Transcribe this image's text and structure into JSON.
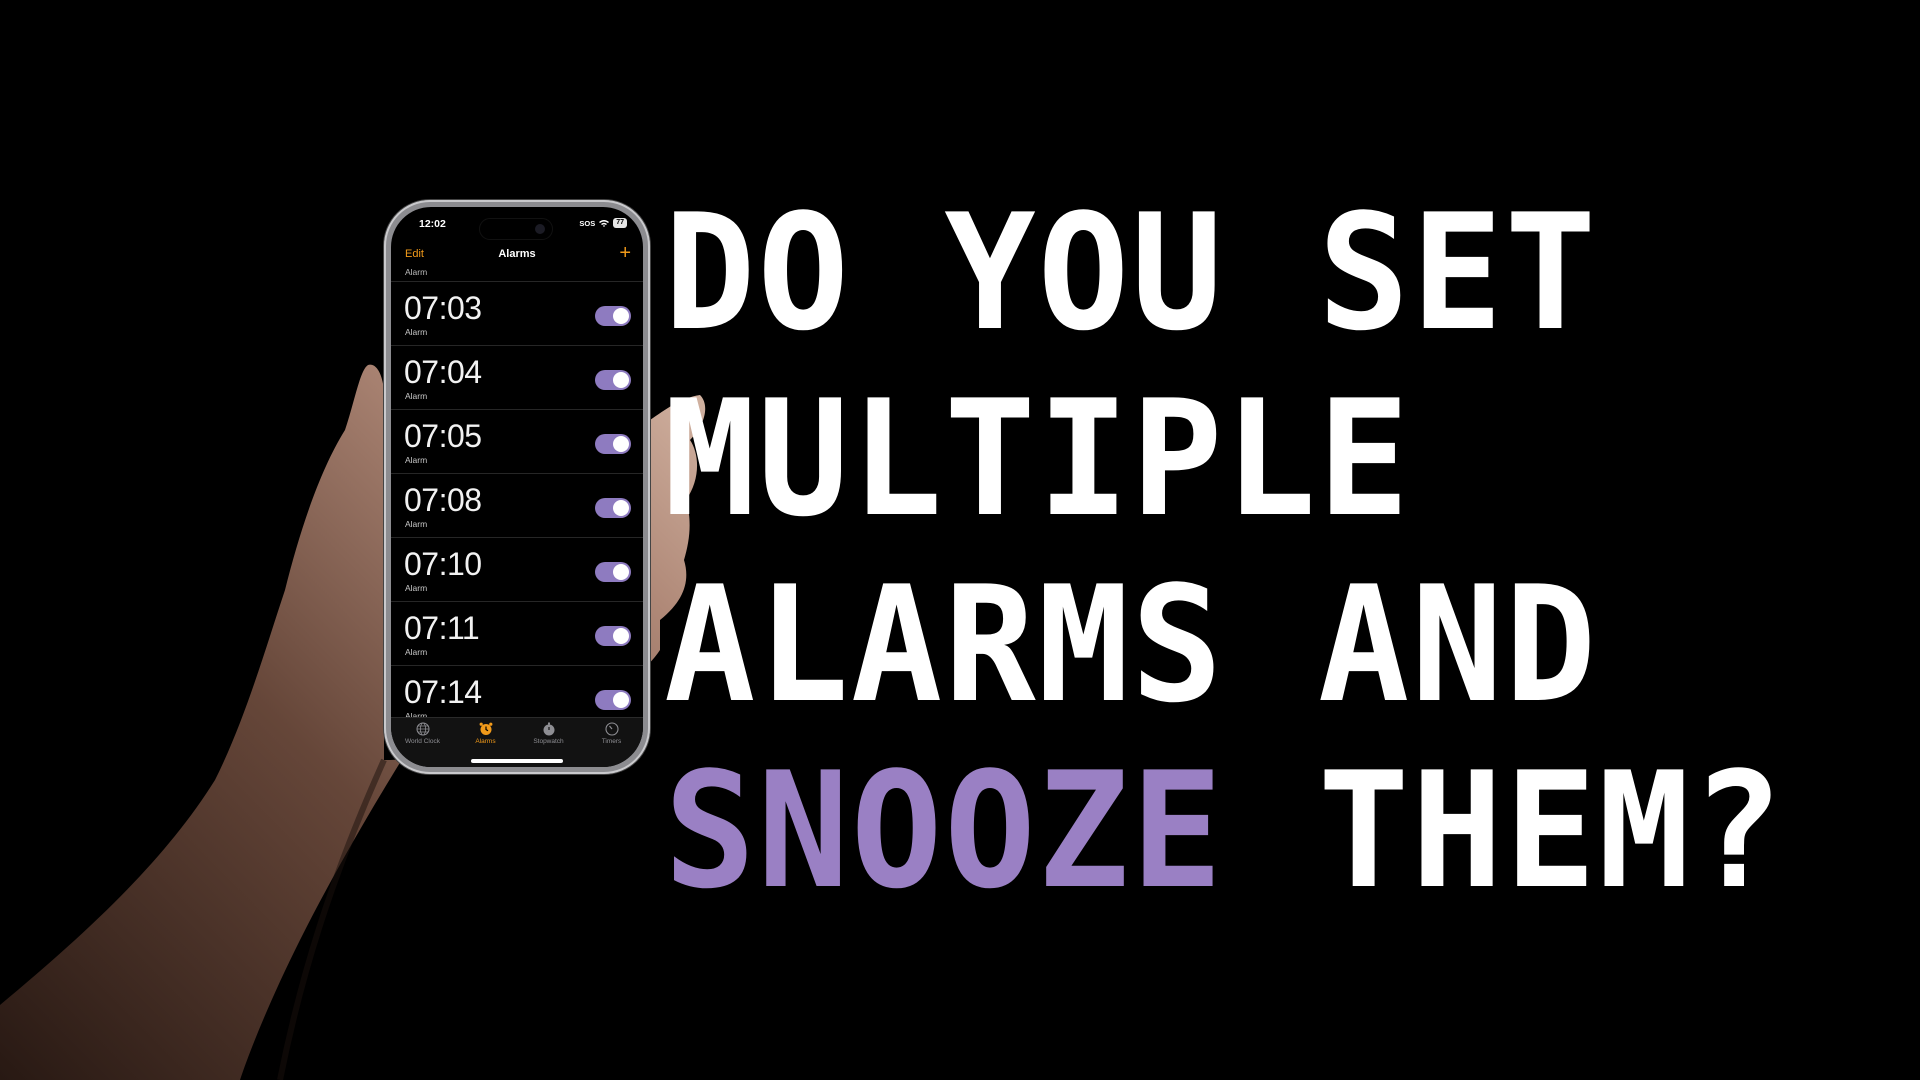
{
  "phone": {
    "status_time": "12:02",
    "status_sos": "SOS",
    "battery": "77",
    "nav": {
      "edit": "Edit",
      "title": "Alarms",
      "add": "+"
    },
    "partial_top_label": "Alarm",
    "alarms": [
      {
        "time": "07:03",
        "label": "Alarm",
        "enabled": true
      },
      {
        "time": "07:04",
        "label": "Alarm",
        "enabled": true
      },
      {
        "time": "07:05",
        "label": "Alarm",
        "enabled": true
      },
      {
        "time": "07:08",
        "label": "Alarm",
        "enabled": true
      },
      {
        "time": "07:10",
        "label": "Alarm",
        "enabled": true
      },
      {
        "time": "07:11",
        "label": "Alarm",
        "enabled": true
      },
      {
        "time": "07:14",
        "label": "Alarm",
        "enabled": true
      }
    ],
    "tabs": [
      {
        "label": "World Clock",
        "icon": "globe-icon",
        "active": false
      },
      {
        "label": "Alarms",
        "icon": "alarm-clock-icon",
        "active": true
      },
      {
        "label": "Stopwatch",
        "icon": "stopwatch-icon",
        "active": false
      },
      {
        "label": "Timers",
        "icon": "timer-icon",
        "active": false
      }
    ],
    "colors": {
      "accent": "#f19a1a",
      "toggle_on": "#8e7bc0"
    }
  },
  "headline": {
    "line1": "DO YOU SET",
    "line2": "MULTIPLE",
    "line3": "ALARMS AND",
    "line4_highlight": "SNOOZE",
    "line4_rest": " THEM?",
    "colors": {
      "text": "#ffffff",
      "highlight": "#9a80c4"
    }
  }
}
